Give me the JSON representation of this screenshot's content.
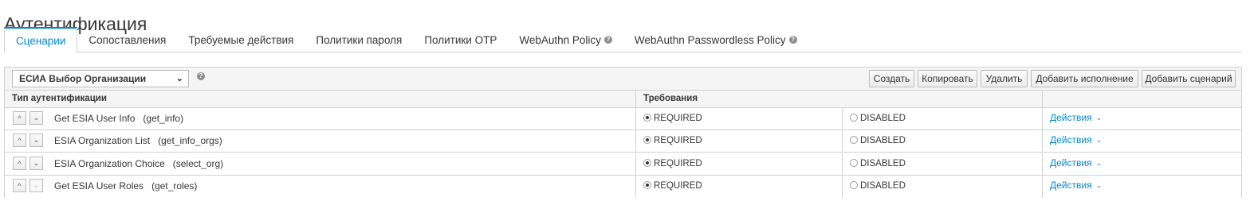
{
  "page": {
    "title": "Аутентификация"
  },
  "tabs": [
    {
      "label": "Сценарии",
      "active": true,
      "help": false
    },
    {
      "label": "Сопоставления",
      "active": false,
      "help": false
    },
    {
      "label": "Требуемые действия",
      "active": false,
      "help": false
    },
    {
      "label": "Политики пароля",
      "active": false,
      "help": false
    },
    {
      "label": "Политики OTP",
      "active": false,
      "help": false
    },
    {
      "label": "WebAuthn Policy",
      "active": false,
      "help": true
    },
    {
      "label": "WebAuthn Passwordless Policy",
      "active": false,
      "help": true
    }
  ],
  "toolbar": {
    "flow_select_value": "ЕСИА Выбор Организации",
    "buttons": {
      "create": "Создать",
      "copy": "Копировать",
      "delete": "Удалить",
      "add_execution": "Добавить исполнение",
      "add_flow": "Добавить сценарий"
    }
  },
  "table": {
    "headers": {
      "auth_type": "Тип аутентификации",
      "requirement": "Требования"
    },
    "rows": [
      {
        "name": "Get ESIA User Info",
        "alias": "(get_info)",
        "required_label": "REQUIRED",
        "disabled_label": "DISABLED",
        "selected": "REQUIRED",
        "actions_label": "Действия"
      },
      {
        "name": "ESIA Organization List",
        "alias": "(get_info_orgs)",
        "required_label": "REQUIRED",
        "disabled_label": "DISABLED",
        "selected": "REQUIRED",
        "actions_label": "Действия"
      },
      {
        "name": "ESIA Organization Choice",
        "alias": "(select_org)",
        "required_label": "REQUIRED",
        "disabled_label": "DISABLED",
        "selected": "REQUIRED",
        "actions_label": "Действия"
      },
      {
        "name": "Get ESIA User Roles",
        "alias": "(get_roles)",
        "required_label": "REQUIRED",
        "disabled_label": "DISABLED",
        "selected": "REQUIRED",
        "actions_label": "Действия"
      }
    ]
  },
  "colors": {
    "link": "#0088ce",
    "border": "#d1d1d1",
    "header_bg": "#f5f5f5"
  },
  "icons": {
    "help": "question-circle-icon",
    "up": "chevron-up-icon",
    "down": "chevron-down-icon"
  }
}
